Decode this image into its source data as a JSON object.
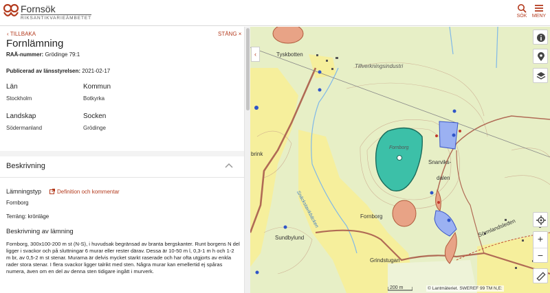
{
  "header": {
    "brand_name": "Fornsök",
    "brand_sub": "RIKSANTIKVARIEÄMBETET",
    "search_label": "SÖK",
    "menu_label": "MENY",
    "accent": "#b33a1d"
  },
  "panel": {
    "back_label": "TILLBAKA",
    "close_label": "STÄNG",
    "title": "Fornlämning",
    "raa_key": "RAÄ-nummer:",
    "raa_value": "Grödinge 79:1",
    "published_key": "Publicerad av länsstyrelsen:",
    "published_value": "2021-02-17",
    "fields": [
      {
        "key": "Län",
        "value": "Stockholm"
      },
      {
        "key": "Kommun",
        "value": "Botkyrka"
      },
      {
        "key": "Landskap",
        "value": "Södermanland"
      },
      {
        "key": "Socken",
        "value": "Grödinge"
      }
    ],
    "section_title": "Beskrivning",
    "lamningstyp_key": "Lämningstyp",
    "definition_link": "Definition och kommentar",
    "lamningstyp_value": "Fornborg",
    "terrain": "Terräng: krönläge",
    "description_heading": "Beskrivning av lämning",
    "description_text": "Fornborg, 300x100-200 m st (N-S), i huvudsak begränsad av branta bergskanter. Runt borgens N del ligger i svackor och på sluttningar 6 murar eller rester därav. Dessa är 10-50 m l, 0,3-1 m h och 1-2 m br, av 0,5-2 m st stenar. Murarna är delvis mycket starkt raserade och har ofta utgjorts av enkla rader stora stenar. I flera svackor ligger talrikt med sten. Några murar kan emellertid ej spåras numera, även om en del av denna sten tidigare ingått i murverk."
  },
  "map": {
    "labels": {
      "tyskbotten": "Tyskbotten",
      "tillverkning": "Tillverkningsindustri",
      "fornborg_feature": "Fornborg",
      "fornborg_place": "Fornborg",
      "snarviks": "Snarviks-",
      "dalen": "dalen",
      "brink": "brink",
      "stream": "Snäckstavikbäcken",
      "sundbylund": "Sundbylund",
      "grindstugan": "Grindstugan",
      "sormlandsleden": "Sörmlandsleden"
    },
    "zoom_in": "+",
    "zoom_out": "−",
    "scale": "200 m",
    "attribution": "© Lantmäteriet. SWEREF 99 TM N,E:",
    "colors": {
      "forest": "#e4edc2",
      "field": "#f6ef9c",
      "selected": "#3cc0a8",
      "other_site": "#e8a386",
      "water": "#7fb8e8"
    },
    "icons": [
      "info-icon",
      "location-pin-icon",
      "layers-icon",
      "locate-icon",
      "ruler-icon"
    ]
  }
}
